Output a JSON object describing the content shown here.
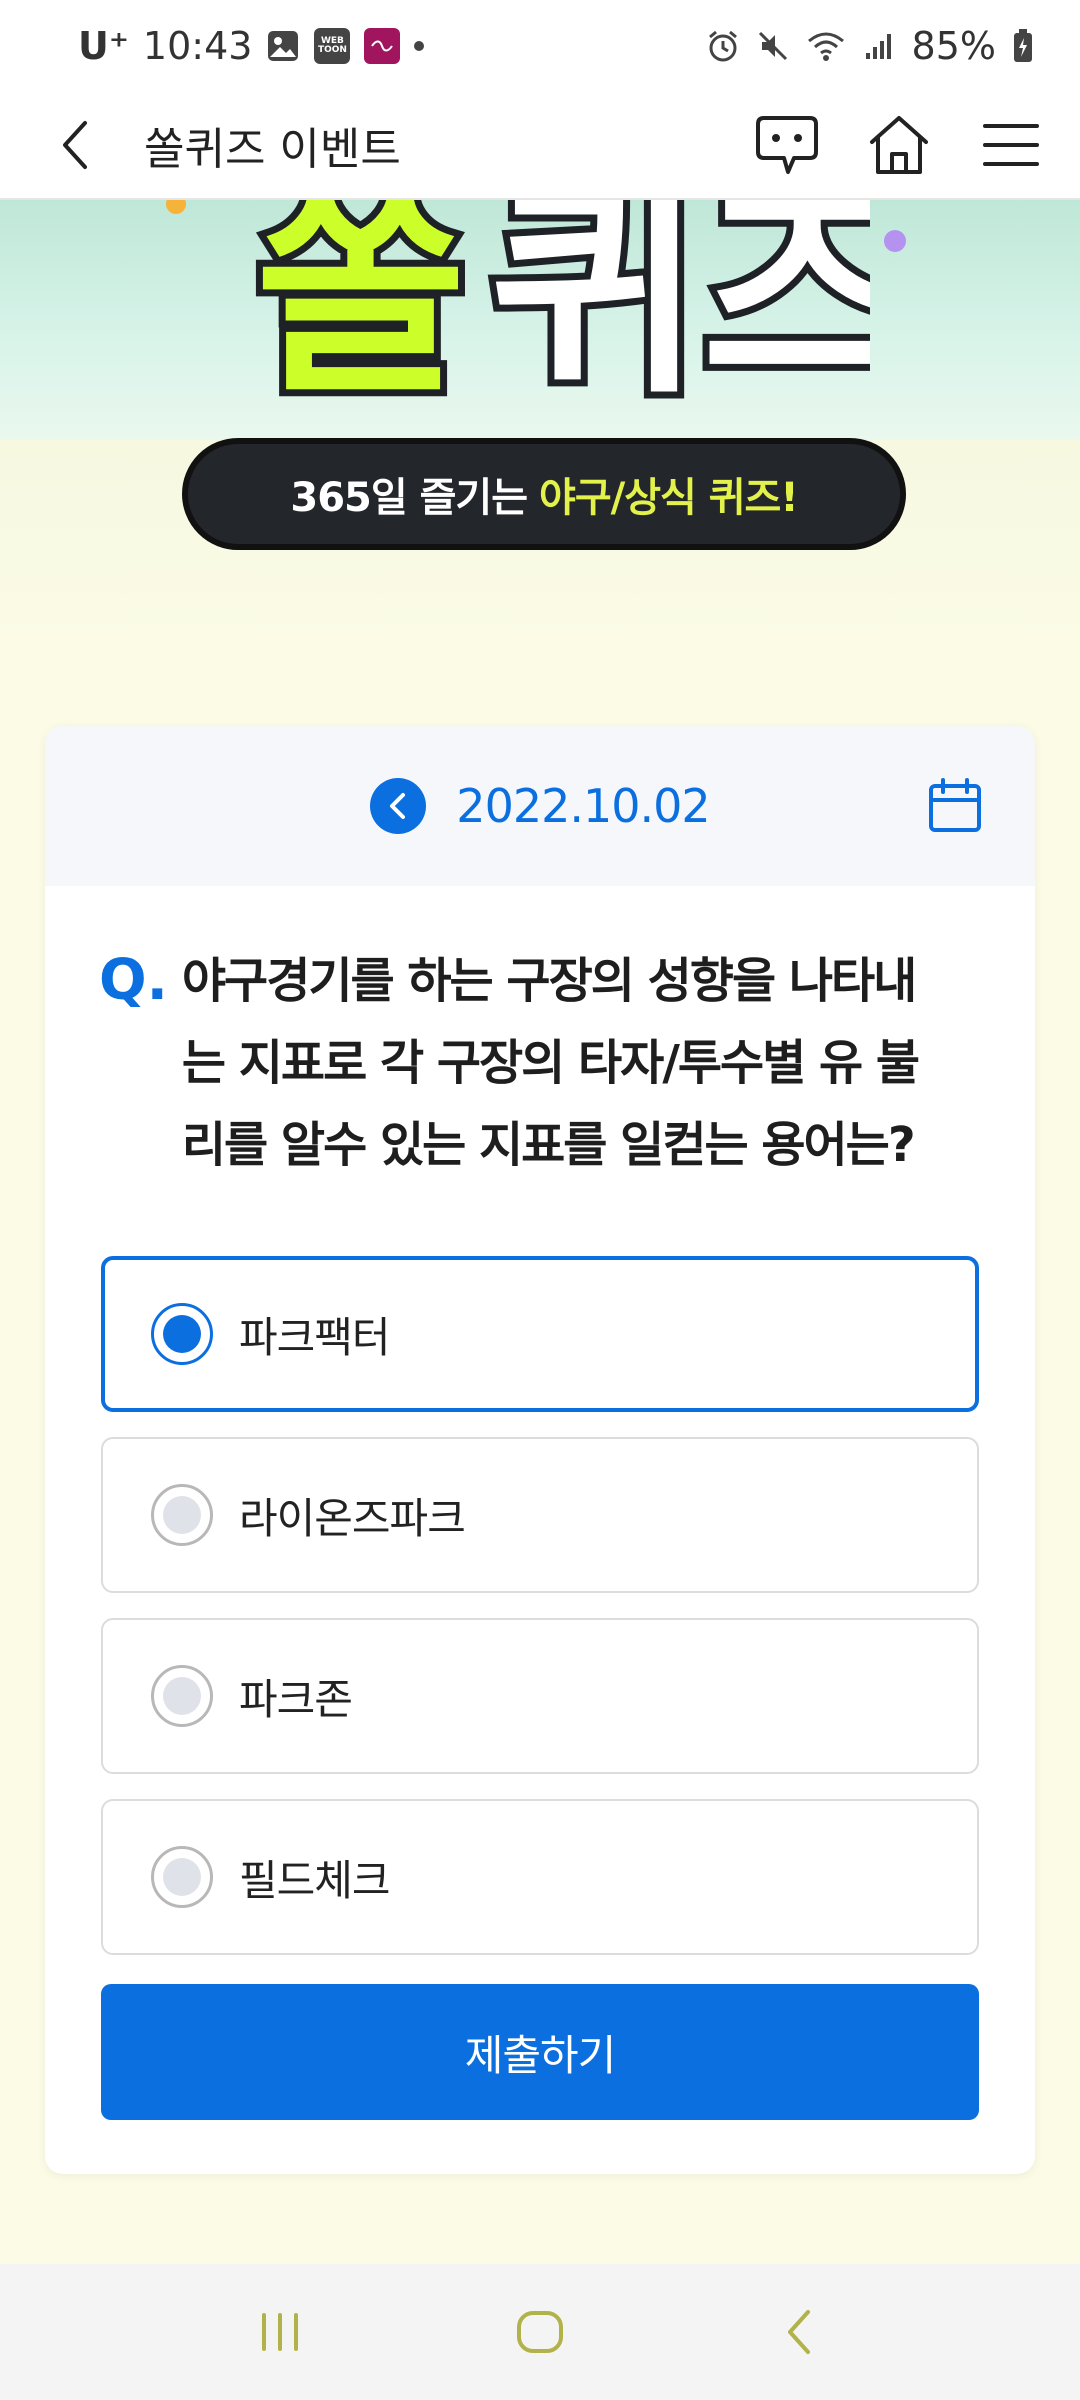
{
  "status_bar": {
    "carrier": "U⁺",
    "time": "10:43",
    "app_icons": [
      "gallery-icon",
      "webtoon-icon",
      "app-icon"
    ],
    "webtoon_label": "WEB TOON",
    "battery": "85%"
  },
  "app_bar": {
    "title": "쏠퀴즈 이벤트"
  },
  "hero": {
    "logo_left": "쏠",
    "logo_right": "퀴즈",
    "banner_prefix": "365일 즐기는",
    "banner_highlight": "야구/상식 퀴즈!"
  },
  "quiz": {
    "date": "2022.10.02",
    "question_mark": "Q.",
    "question_lines": [
      "야구경기를 하는 구장의 성향을 나타내",
      "는 지표로 각 구장의 타자/투수별 유 불",
      "리를 알수 있는 지표를 일컫는 용어는?"
    ],
    "options": [
      {
        "label": "파크팩터",
        "selected": true
      },
      {
        "label": "라이온즈파크",
        "selected": false
      },
      {
        "label": "파크존",
        "selected": false
      },
      {
        "label": "필드체크",
        "selected": false
      }
    ],
    "submit_label": "제출하기"
  },
  "colors": {
    "accent": "#0b6fe0",
    "highlight": "#e3f24a"
  }
}
